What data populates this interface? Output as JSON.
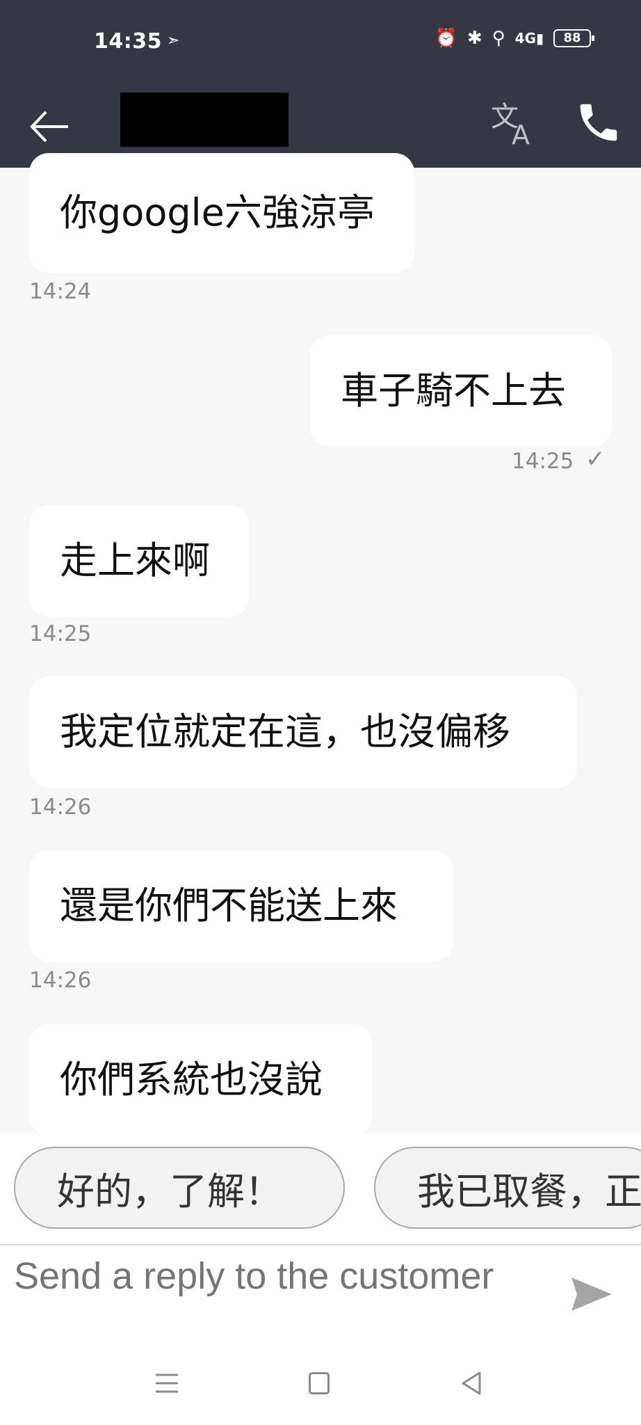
{
  "status_bar": {
    "time": "14:35",
    "battery": "88",
    "icons": [
      "send-icon",
      "alarm-icon",
      "bluetooth-icon",
      "location-icon",
      "signal-4g-icon",
      "battery-icon"
    ]
  },
  "header": {
    "back_icon": "arrow-left-icon",
    "translate_icon": "translate-icon",
    "call_icon": "phone-icon"
  },
  "messages": [
    {
      "side": "in",
      "text": "你google六強涼亭",
      "time": "14:24"
    },
    {
      "side": "out",
      "text": "車子騎不上去",
      "time": "14:25",
      "status": "✓"
    },
    {
      "side": "in",
      "text": "走上來啊",
      "time": "14:25"
    },
    {
      "side": "in",
      "text": "我定位就定在這，也沒偏移",
      "time": "14:26"
    },
    {
      "side": "in",
      "text": "還是你們不能送上來",
      "time": "14:26"
    },
    {
      "side": "in",
      "text": "你們系統也沒說",
      "time": ""
    }
  ],
  "quick_replies": [
    "好的，了解！",
    "我已取餐，正"
  ],
  "composer": {
    "placeholder": "Send a reply to the customer",
    "send_icon": "send-icon"
  },
  "colors": {
    "header_bg": "#353843",
    "chat_bg": "#f7f7f7",
    "bubble_bg": "#ffffff",
    "time_text": "#8a8a8a"
  }
}
